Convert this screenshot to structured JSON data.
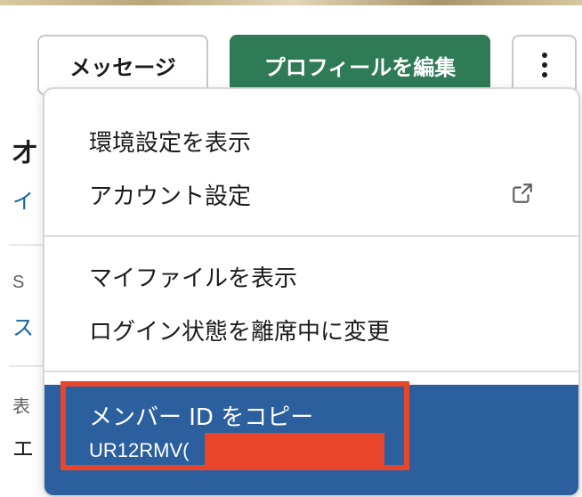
{
  "header": {
    "message_label": "メッセージ",
    "edit_profile_label": "プロフィールを編集"
  },
  "background": {
    "fragment_a": "才",
    "fragment_b": "イ",
    "fragment_c": "S",
    "fragment_d": "ス",
    "fragment_e": "表",
    "fragment_f": "エ"
  },
  "menu": {
    "items": [
      {
        "label": "環境設定を表示"
      },
      {
        "label": "アカウント設定"
      },
      {
        "label": "マイファイルを表示"
      },
      {
        "label": "ログイン状態を離席中に変更"
      },
      {
        "label": "メンバー ID をコピー"
      }
    ],
    "member_id_partial": "UR12RMV("
  },
  "colors": {
    "edit_button_bg": "#2f7a57",
    "highlight_bg": "#2b5f9e",
    "annotation": "#e8452a"
  },
  "icons": {
    "more": "kebab-vertical-icon",
    "external": "external-link-icon"
  }
}
